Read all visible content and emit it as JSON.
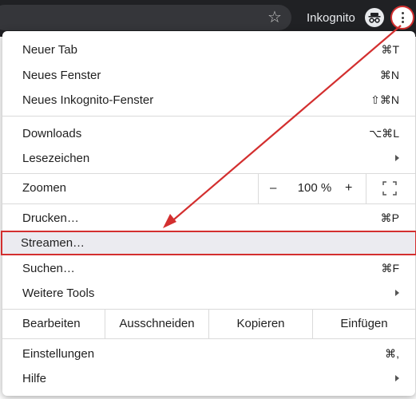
{
  "topbar": {
    "bookmark_icon": "star-icon",
    "incognito_label": "Inkognito",
    "incognito_icon": "incognito-icon",
    "menu_icon": "kebab-menu-icon"
  },
  "menu": {
    "new_tab": {
      "label": "Neuer Tab",
      "shortcut": "⌘T"
    },
    "new_window": {
      "label": "Neues Fenster",
      "shortcut": "⌘N"
    },
    "new_incognito": {
      "label": "Neues Inkognito-Fenster",
      "shortcut": "⇧⌘N"
    },
    "downloads": {
      "label": "Downloads",
      "shortcut": "⌥⌘L"
    },
    "bookmarks": {
      "label": "Lesezeichen"
    },
    "zoom": {
      "label": "Zoomen",
      "minus": "–",
      "value": "100 %",
      "plus": "+"
    },
    "print": {
      "label": "Drucken…",
      "shortcut": "⌘P"
    },
    "cast": {
      "label": "Streamen…"
    },
    "find": {
      "label": "Suchen…",
      "shortcut": "⌘F"
    },
    "more_tools": {
      "label": "Weitere Tools"
    },
    "edit": {
      "label": "Bearbeiten",
      "cut": "Ausschneiden",
      "copy": "Kopieren",
      "paste": "Einfügen"
    },
    "settings": {
      "label": "Einstellungen",
      "shortcut": "⌘,"
    },
    "help": {
      "label": "Hilfe"
    }
  },
  "colors": {
    "annotation": "#d32f2f",
    "highlight": "#ebebf0",
    "topbar": "#202124"
  }
}
